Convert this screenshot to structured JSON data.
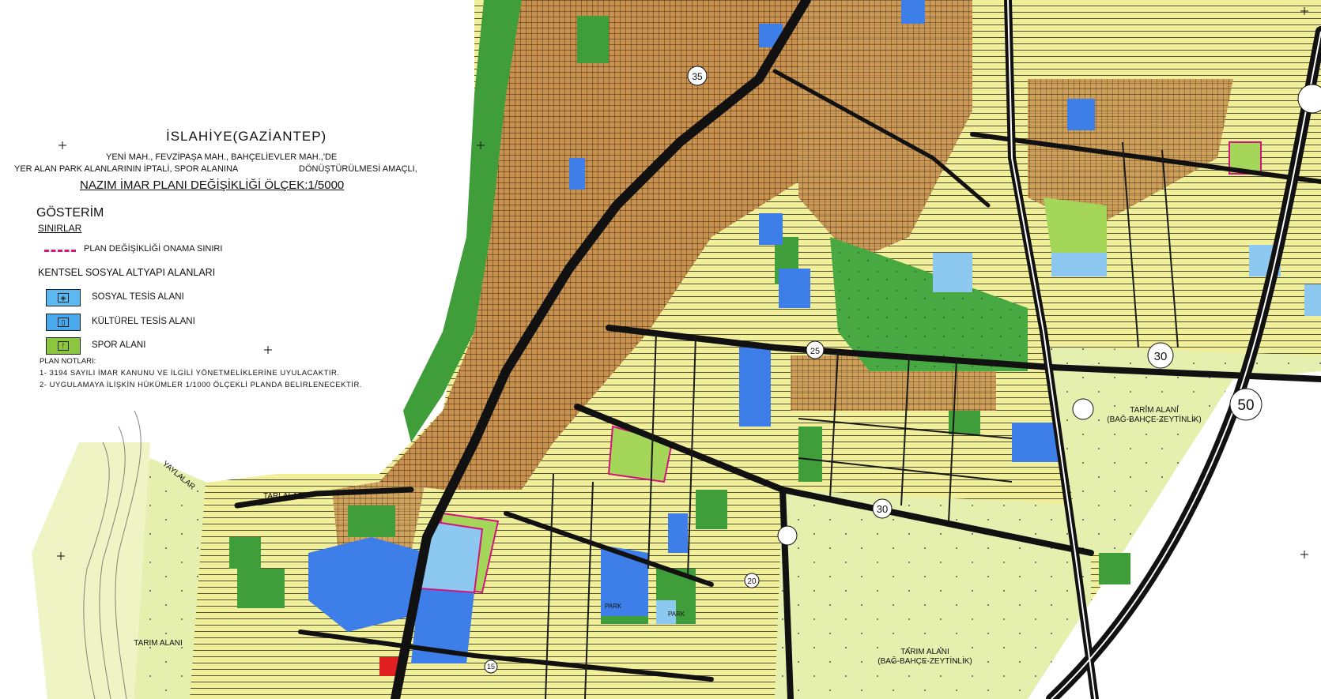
{
  "title": "İSLAHİYE(GAZİANTEP)",
  "subtitle_line1": "YENİ MAH., FEVZİPAŞA MAH., BAHÇELİEVLER MAH.,'DE",
  "subtitle_line2a": "YER ALAN PARK ALANLARININ İPTALİ, SPOR ALANINA",
  "subtitle_line2b": "DÖNÜŞTÜRÜLMESİ AMAÇLI,",
  "plan_title": "NAZIM İMAR PLANI DEĞİŞİKLİĞİ ÖLÇEK:1/5000",
  "legend": {
    "heading": "GÖSTERİM",
    "boundaries_heading": "SINIRLAR",
    "boundary_label": "PLAN DEĞİŞİKLİĞİ ONAMA SINIRI",
    "boundary_color": "#d4147a",
    "social_heading": "KENTSEL SOSYAL ALTYAPI ALANLARI",
    "items": [
      {
        "label": "SOSYAL TESİS ALANI",
        "color": "#5bb8f0",
        "icon": "social-facility-icon"
      },
      {
        "label": "KÜLTÜREL TESİS ALANI",
        "color": "#4aa8ec",
        "icon": "cultural-facility-icon"
      },
      {
        "label": "SPOR ALANI",
        "color": "#8cc63e",
        "icon": "sports-area-icon"
      }
    ]
  },
  "plan_notes": {
    "heading": "PLAN NOTLARI:",
    "note1": "1- 3194 SAYILI İMAR KANUNU VE İLGİLİ YÖNETMELİKLERİNE UYULACAKTIR.",
    "note2": "2- UYGULAMAYA İLİŞKİN HÜKÜMLER 1/1000 ÖLÇEKLİ PLANDA BELİRLENECEKTİR."
  },
  "map_labels": {
    "road_35": "35",
    "road_25": "25",
    "road_30": "30",
    "road_50": "50",
    "road_20": "20",
    "road_15": "15",
    "farm1_line1": "TARIM ALANI",
    "farm1_line2": "(BAĞ-BAHÇE-ZEYTİNLİK)",
    "farm2_line1": "TARIM ALANI",
    "farm2_line2": "(BAĞ-BAHÇE-ZEYTİNLİK)",
    "farm3": "TARIM ALANI",
    "yaylalar": "YAYLALAR",
    "tarlalar": "TARLALAR",
    "park1": "PARK",
    "park2": "PARK"
  },
  "colors": {
    "residential": "#f2ef9a",
    "dense_residential": "#c8914e",
    "green": "#3f9e3a",
    "farmland": "#e5efae",
    "blue_facility": "#3d7ee8",
    "light_blue": "#8cc8f0",
    "road": "#111111"
  }
}
